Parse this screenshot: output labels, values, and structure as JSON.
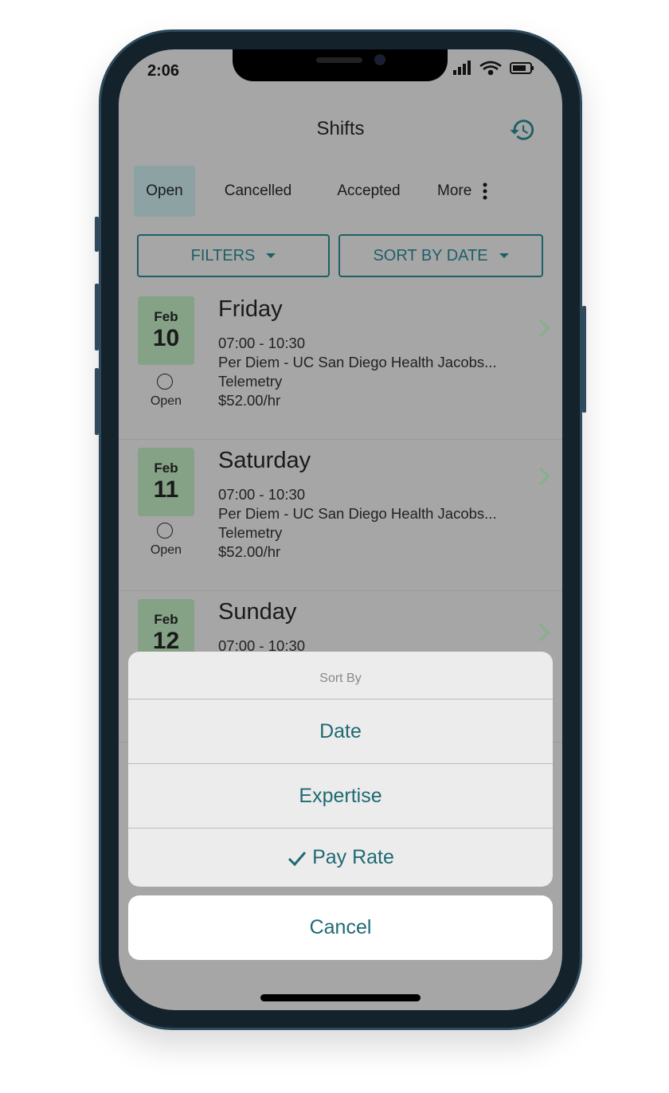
{
  "status_bar": {
    "time": "2:06"
  },
  "header": {
    "title": "Shifts",
    "history_icon": "history-icon"
  },
  "tabs": [
    {
      "label": "Open",
      "active": true
    },
    {
      "label": "Cancelled"
    },
    {
      "label": "Accepted"
    },
    {
      "label": "More"
    }
  ],
  "toolbar": {
    "filters_label": "FILTERS",
    "sort_label": "SORT BY DATE"
  },
  "shifts": [
    {
      "month": "Feb",
      "day_num": "10",
      "status": "Open",
      "weekday": "Friday",
      "time": "07:00 - 10:30",
      "facility": "Per Diem - UC San Diego Health Jacobs...",
      "unit": "Telemetry",
      "rate": "$52.00/hr"
    },
    {
      "month": "Feb",
      "day_num": "11",
      "status": "Open",
      "weekday": "Saturday",
      "time": "07:00 - 10:30",
      "facility": "Per Diem - UC San Diego Health Jacobs...",
      "unit": "Telemetry",
      "rate": "$52.00/hr"
    },
    {
      "month": "Feb",
      "day_num": "12",
      "weekday": "Sunday",
      "time": "07:00 - 10:30"
    }
  ],
  "sort_sheet": {
    "title": "Sort By",
    "options": [
      {
        "label": "Date"
      },
      {
        "label": "Expertise"
      },
      {
        "label": "Pay Rate",
        "selected": true
      }
    ],
    "cancel_label": "Cancel"
  },
  "colors": {
    "accent": "#1e6a73",
    "date_badge": "#85a186",
    "overlay": "#a6a6a6"
  }
}
